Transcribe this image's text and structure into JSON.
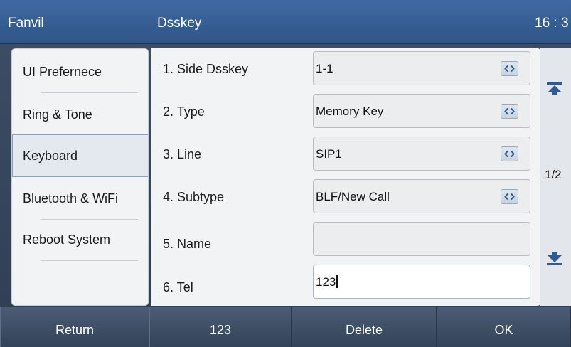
{
  "header": {
    "brand": "Fanvil",
    "title": "Dsskey",
    "clock": "16 : 3"
  },
  "sidebar": {
    "items": [
      {
        "label": "UI Prefernece"
      },
      {
        "label": "Ring & Tone"
      },
      {
        "label": "Keyboard",
        "active": true
      },
      {
        "label": "Bluetooth & WiFi"
      },
      {
        "label": "Reboot System"
      }
    ]
  },
  "form": {
    "rows": [
      {
        "label": "1. Side Dsskey",
        "value": "1-1",
        "selectable": true
      },
      {
        "label": "2. Type",
        "value": "Memory Key",
        "selectable": true
      },
      {
        "label": "3. Line",
        "value": "SIP1",
        "selectable": true
      },
      {
        "label": "4. Subtype",
        "value": "BLF/New Call",
        "selectable": true
      },
      {
        "label": "5. Name",
        "value": "",
        "selectable": false
      },
      {
        "label": "6. Tel",
        "value": "123",
        "selectable": false,
        "focused": true
      }
    ]
  },
  "scroller": {
    "page": "1/2",
    "top_icon": "scroll-top-icon",
    "bottom_icon": "scroll-bottom-icon"
  },
  "softkeys": {
    "return": "Return",
    "ime": "123",
    "delete": "Delete",
    "ok": "OK"
  },
  "colors": {
    "header": "#35598d",
    "panel": "#f2f3f5",
    "softkeys": "#3e4e66"
  }
}
